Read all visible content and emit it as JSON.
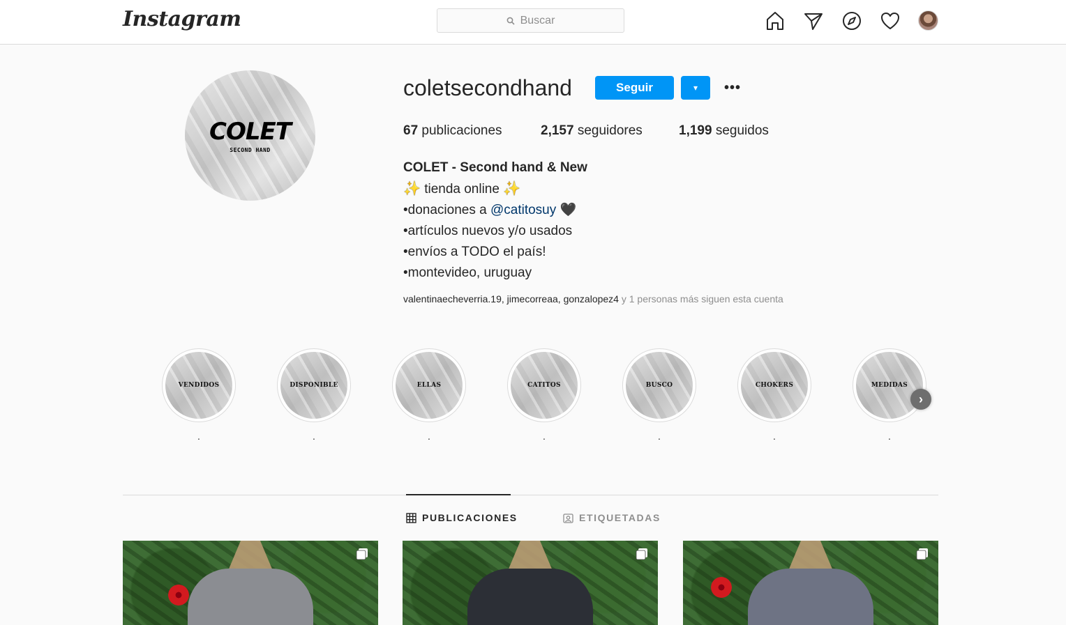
{
  "header": {
    "logo": "Instagram",
    "search_placeholder": "Buscar",
    "nav_icons": [
      "home-icon",
      "direct-icon",
      "explore-icon",
      "activity-icon",
      "profile-avatar"
    ]
  },
  "profile": {
    "avatar_title": "COLET",
    "avatar_subtitle": "SECOND HAND",
    "username": "coletsecondhand",
    "follow_label": "Seguir",
    "dropdown_symbol": "▾",
    "more_symbol": "•••",
    "stats": {
      "posts_count": "67",
      "posts_label": "publicaciones",
      "followers_count": "2,157",
      "followers_label": "seguidores",
      "following_count": "1,199",
      "following_label": "seguidos"
    },
    "bio": {
      "name": "COLET - Second hand & New",
      "line1": "tienda online",
      "line2_prefix": "•donaciones a",
      "line2_mention": "@catitosuy",
      "line3": "•artículos nuevos y/o usados",
      "line4": "•envíos a TODO el país!",
      "line5": "•montevideo, uruguay",
      "sparkle": "✨",
      "heart": "🖤"
    },
    "followed_by": {
      "users": "valentinaecheverria.19, jimecorreaa, gonzalopez4",
      "rest": "y 1 personas más siguen esta cuenta"
    }
  },
  "highlights": [
    {
      "label": "VENDIDOS",
      "caption": "."
    },
    {
      "label": "DISPONIBLE",
      "caption": "."
    },
    {
      "label": "ELLAS",
      "caption": "."
    },
    {
      "label": "CATITOS",
      "caption": "."
    },
    {
      "label": "BUSCO",
      "caption": "."
    },
    {
      "label": "CHOKERS",
      "caption": "."
    },
    {
      "label": "MEDIDAS",
      "caption": "."
    }
  ],
  "tabs": {
    "posts": "PUBLICACIONES",
    "tagged": "ETIQUETADAS"
  },
  "posts": [
    {
      "garment_color": "#8b8d92",
      "accent": "#d6262e"
    },
    {
      "garment_color": "#2c2f36",
      "accent": "#cfcfcf"
    },
    {
      "garment_color": "#6e7384",
      "accent": "#5c6072"
    }
  ]
}
